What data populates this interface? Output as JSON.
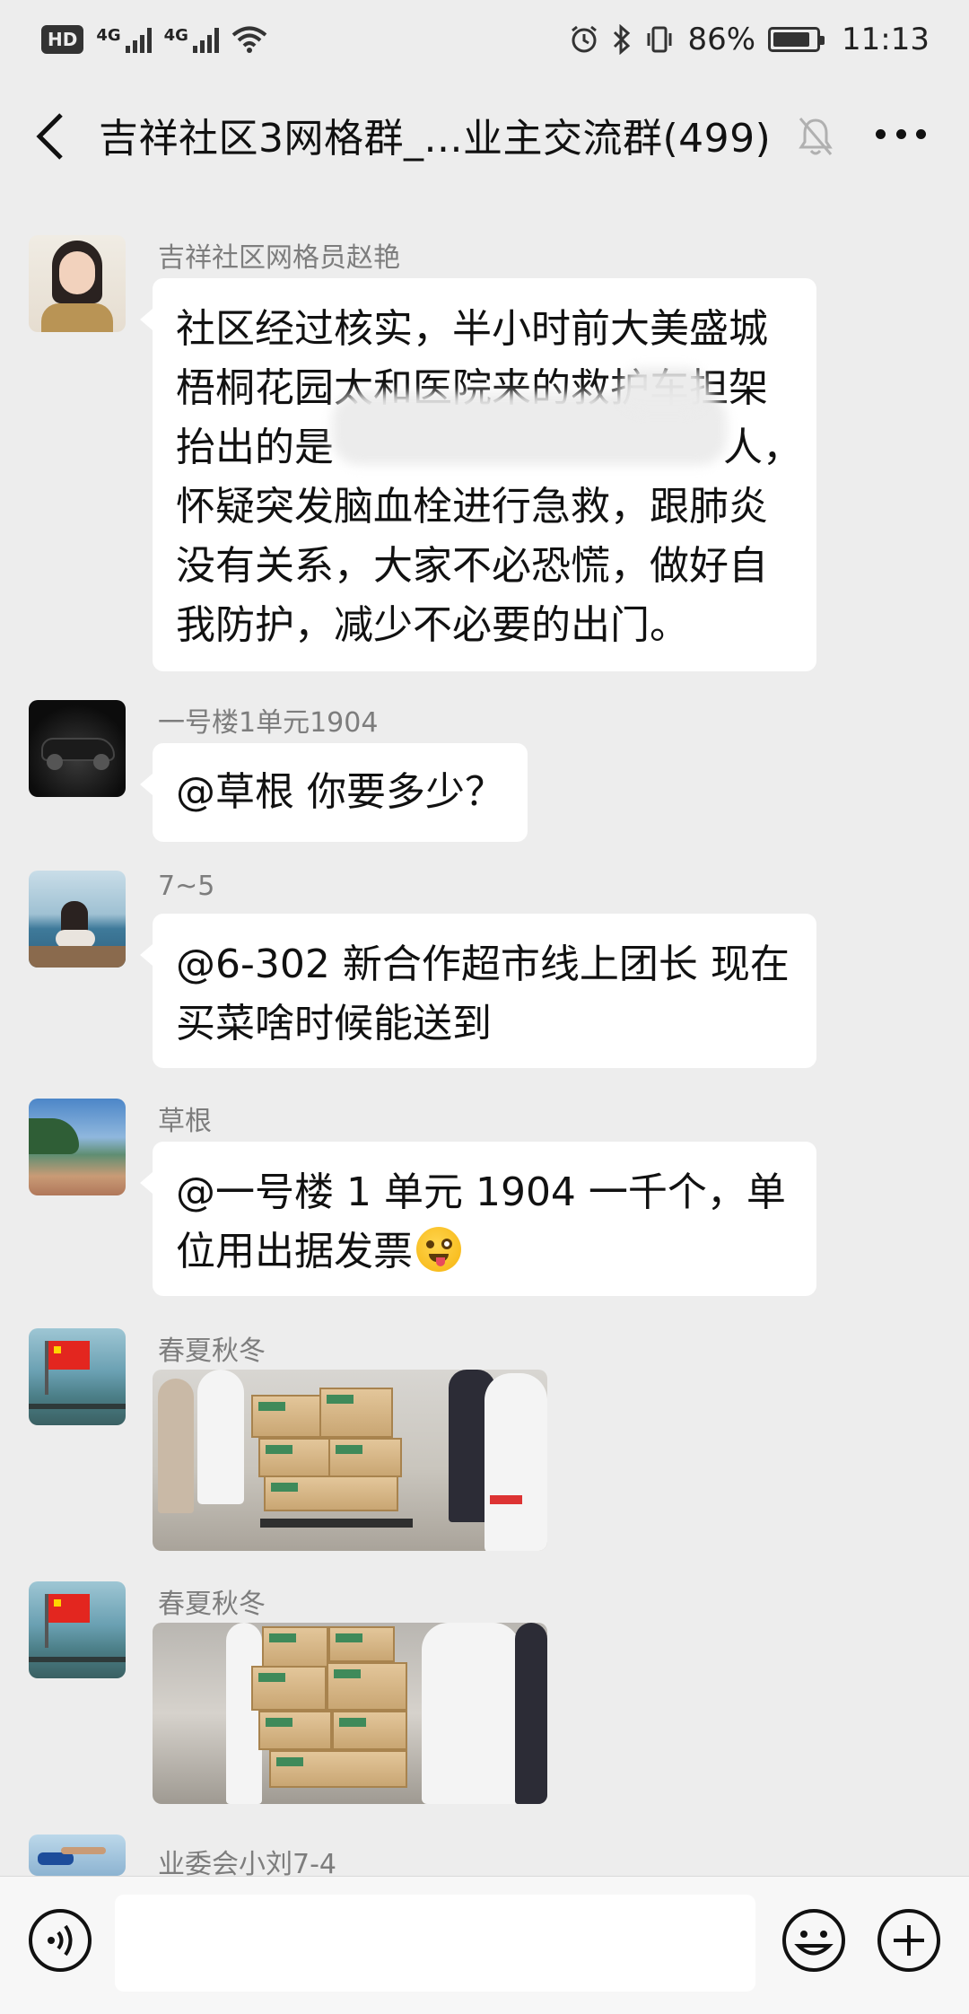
{
  "status_bar": {
    "hd": "HD",
    "sim1_net": "4G",
    "sim2_net": "4G",
    "battery": "86%",
    "battery_level": 0.86,
    "time": "11:13"
  },
  "header": {
    "title": "吉祥社区3网格群_...业主交流群(499)"
  },
  "messages": [
    {
      "sender": "吉祥社区网格员赵艳",
      "type": "text",
      "lines": [
        "社区经过核实，半小时前大美盛城",
        "梧桐花园太和医院来的救护车担架",
        "抬出的是",
        "怀疑突发脑血栓进行急救，跟肺炎",
        "没有关系，大家不必恐慌，做好自",
        "我防护，减少不必要的出门。"
      ],
      "line3_tail": "人，"
    },
    {
      "sender": "一号楼1单元1904",
      "type": "text",
      "lines": [
        "@草根  你要多少？"
      ]
    },
    {
      "sender": "7~5",
      "type": "text",
      "lines": [
        "@6-302 新合作超市线上团长  现在",
        "买菜啥时候能送到"
      ]
    },
    {
      "sender": "草根",
      "type": "text",
      "lines": [
        "@一号楼 1 单元 1904  一千个，单",
        "位用出据发票"
      ]
    },
    {
      "sender": "春夏秋冬",
      "type": "image"
    },
    {
      "sender": "春夏秋冬",
      "type": "image"
    },
    {
      "sender": "业委会小刘7-4",
      "type": "partial"
    }
  ],
  "input_bar": {
    "placeholder": ""
  },
  "icons": {
    "back": "back-arrow-icon",
    "mute": "mute-bell-icon",
    "more": "more-dots-icon",
    "voice": "voice-icon",
    "emoji": "emoji-icon",
    "plus": "plus-icon"
  }
}
